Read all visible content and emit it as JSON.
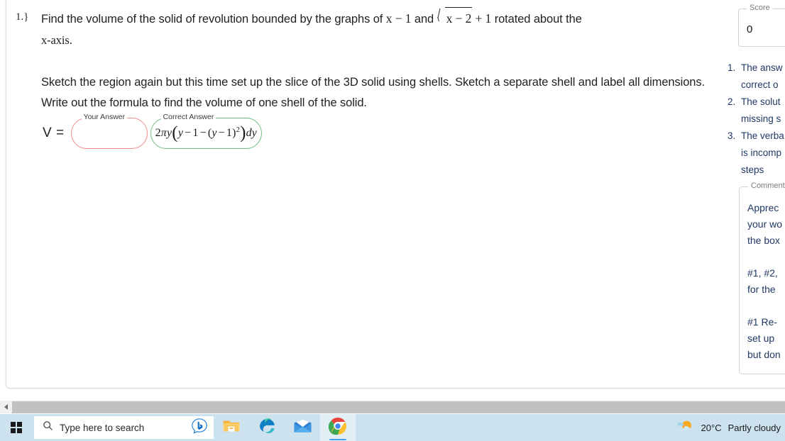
{
  "question": {
    "number_label": "1.}",
    "line1_pre": "Find the volume of the solid of revolution bounded by the graphs of ",
    "expr1": "x − 1",
    "line1_mid": " and ",
    "sqrt_inner": "x − 2",
    "expr2": " + 1",
    "line1_post": " rotated about the",
    "line2": "x-axis.",
    "paragraph2": "Sketch the region again but this time set up the slice of the 3D solid using shells. Sketch a separate shell and label all dimensions. Write out the formula to find the volume of one shell of the solid.",
    "v_equals": "V ="
  },
  "answers": {
    "your_answer_legend": "Your Answer",
    "your_answer_value": "",
    "correct_answer_legend": "Correct Answer",
    "correct_answer_formula": "2πy(y − 1 − (y − 1)²)dy"
  },
  "sidebar": {
    "score_legend": "Score",
    "score_value": "0",
    "feedback_items": [
      "The answ   correct o",
      "The solut   missing s",
      "The verba   is incomp   steps"
    ],
    "feedback_lines": [
      [
        "The answ",
        "correct o"
      ],
      [
        "The solut",
        "missing s"
      ],
      [
        "The verba",
        "is incomp",
        "steps"
      ]
    ],
    "comment_legend": "Comment",
    "comment_paragraphs": [
      [
        "Apprec",
        "your wo",
        "the box"
      ],
      [
        "#1, #2,",
        "for the "
      ],
      [
        "#1 Re-",
        "set up ",
        "but don"
      ]
    ]
  },
  "scrollbar": {
    "left_arrow": "◀"
  },
  "taskbar": {
    "start_label": "start-menu",
    "search_placeholder": "Type here to search",
    "search_value": "",
    "icons": [
      {
        "name": "file-explorer-icon",
        "label": "File Explorer"
      },
      {
        "name": "edge-icon",
        "label": "Microsoft Edge"
      },
      {
        "name": "mail-icon",
        "label": "Mail"
      },
      {
        "name": "chrome-icon",
        "label": "Google Chrome"
      }
    ],
    "weather_temp": "20°C",
    "weather_desc": "Partly cloudy"
  },
  "colors": {
    "your_answer_border": "#f08a8a",
    "correct_answer_border": "#72bd7f",
    "feedback_text": "#1f3864",
    "taskbar_bg": "#cde2ef",
    "active_tab_underline": "#4a9fe0"
  }
}
